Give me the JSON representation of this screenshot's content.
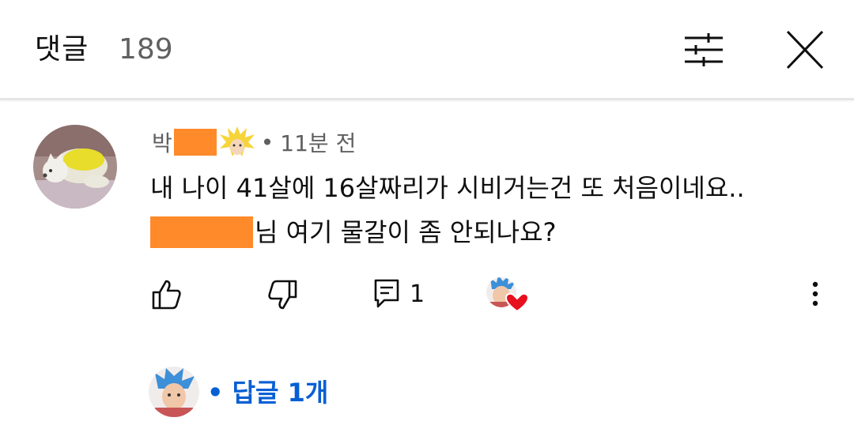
{
  "header": {
    "title": "댓글",
    "count": "189",
    "filter_icon": "sort-sliders-icon",
    "close_icon": "close-icon"
  },
  "comment": {
    "author_prefix": "박",
    "meta_separator": "•",
    "time": "11분 전",
    "text_line1": "내 나이 41살에 16살짜리가 시비거는건 또 처음이네요..",
    "text_line2": "님 여기 물갈이 좀 안되나요?",
    "reply_count": "1",
    "redaction_color": "#ff8a2a"
  },
  "replies": {
    "separator": "•",
    "label": "답글 1개",
    "color": "#065fd4"
  }
}
